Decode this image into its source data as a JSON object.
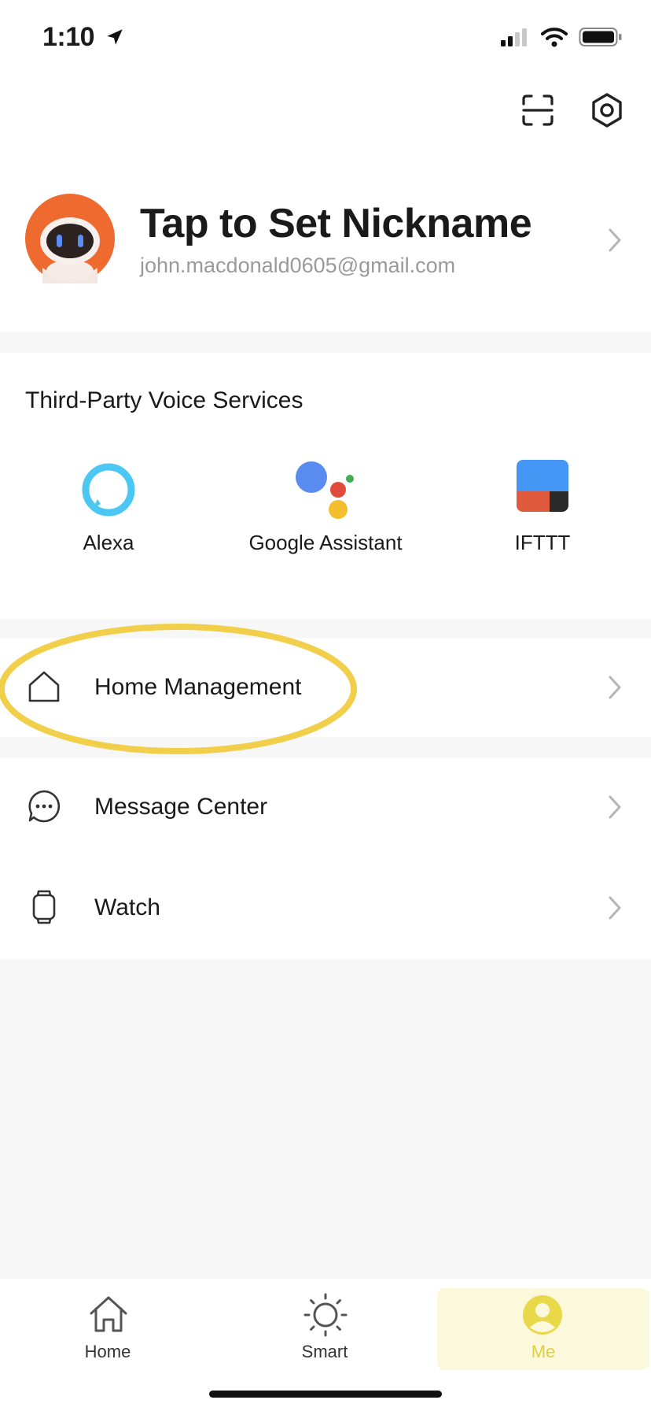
{
  "status_bar": {
    "time": "1:10"
  },
  "profile": {
    "nickname_prompt": "Tap to Set Nickname",
    "email": "john.macdonald0605@gmail.com"
  },
  "voice_services": {
    "title": "Third-Party Voice Services",
    "items": [
      {
        "label": "Alexa",
        "icon": "alexa-icon"
      },
      {
        "label": "Google Assistant",
        "icon": "google-assistant-icon"
      },
      {
        "label": "IFTTT",
        "icon": "ifttt-icon"
      }
    ]
  },
  "menu": {
    "home_management": "Home Management",
    "message_center": "Message Center",
    "watch": "Watch"
  },
  "tabs": [
    {
      "label": "Home",
      "icon": "home-icon",
      "active": false
    },
    {
      "label": "Smart",
      "icon": "sun-icon",
      "active": false
    },
    {
      "label": "Me",
      "icon": "person-icon",
      "active": true
    }
  ],
  "colors": {
    "accent_yellow": "#f2cf4a",
    "active_tab_bg": "#fbf8dc",
    "active_tab_fg": "#e8d84a",
    "avatar_orange": "#ef6a2f"
  }
}
